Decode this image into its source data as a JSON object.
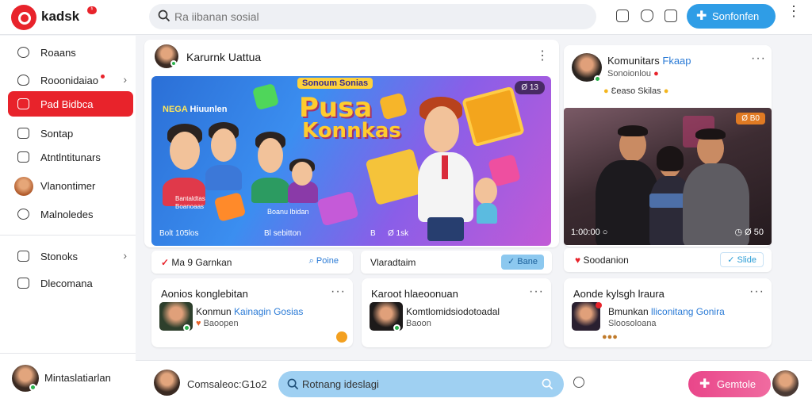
{
  "topbar": {
    "brand": "kadsk",
    "brand_badge": "ʰ",
    "search_placeholder": "Ra iibanan sosial",
    "primary_button": "Sonfonfen",
    "icons": [
      "phone-icon",
      "shield-icon",
      "smile-icon"
    ]
  },
  "sidebar": {
    "items": [
      {
        "label": "Roaans",
        "icon": "user-icon"
      },
      {
        "label": "Rooonidaiao",
        "icon": "heart-icon",
        "has_chevron": true,
        "has_dot": true
      },
      {
        "label": "Pad Bidbca",
        "icon": "grid-icon",
        "active": true
      },
      {
        "label": "Sontap",
        "icon": "chat-icon"
      },
      {
        "label": "Atntlntitunars",
        "icon": "document-icon"
      },
      {
        "label": "Vlanontimer",
        "icon": "avatar"
      },
      {
        "label": "Malnoledes",
        "icon": "user-icon"
      }
    ],
    "bottom_items": [
      {
        "label": "Stonoks",
        "icon": "grid-icon",
        "has_chevron": true
      },
      {
        "label": "Dlecomana",
        "icon": "edit-icon"
      }
    ],
    "user": {
      "name": "Mintaslatiarlan"
    }
  },
  "feed": {
    "post": {
      "author": "Karurnk Uattua",
      "banner": {
        "tag": "Sonoum Sonias",
        "title_line1": "Pusa",
        "title_line2": "Konnkas",
        "top_left_a": "NEGA",
        "top_left_b": "Hiuunlen",
        "chip": "Ø 13",
        "footer": "Bolt 105los",
        "controls": [
          "Bl sebitton",
          "B",
          "Ø 1sk"
        ],
        "caption_a": "Bantaldtas",
        "caption_b": "Boanoaas",
        "caption_c": "Boanu lbidan"
      }
    },
    "post_actions": {
      "left": "Ma 9 Garnkan",
      "right": "Poine"
    },
    "middle_action": {
      "left": "Vlaradtaim",
      "right": "Bane"
    },
    "cards": [
      {
        "title": "Aonios konglebitan",
        "name_a": "Konmun",
        "name_b": "Kainagin Gosias",
        "sub": "Baoopen"
      },
      {
        "title": "Karoot hlaeoonuan",
        "name_a": "Komtlomidsiodotoadal",
        "name_b": "",
        "sub": "Baoon"
      },
      {
        "title": "Aonde kylsgh lraura",
        "name_a": "Bmunkan",
        "name_b": "lliconitang Gonira",
        "sub": "Sloosoloana"
      }
    ]
  },
  "right": {
    "profile": {
      "name": "Komunitars",
      "tag": "Fkaap",
      "sub": "Sonoionlou",
      "reactions": "Ɛeaso  Skilas"
    },
    "video": {
      "chip": "Ø B0",
      "time": "1:00:00",
      "ctrl": "Ø 50"
    },
    "action": {
      "left": "Soodanion",
      "right": "Slide"
    }
  },
  "bottom_bar": {
    "label": "Comsaleoc:G1o2",
    "search_value": "Rotnang ideslagi",
    "gen_button": "Gemtole"
  }
}
